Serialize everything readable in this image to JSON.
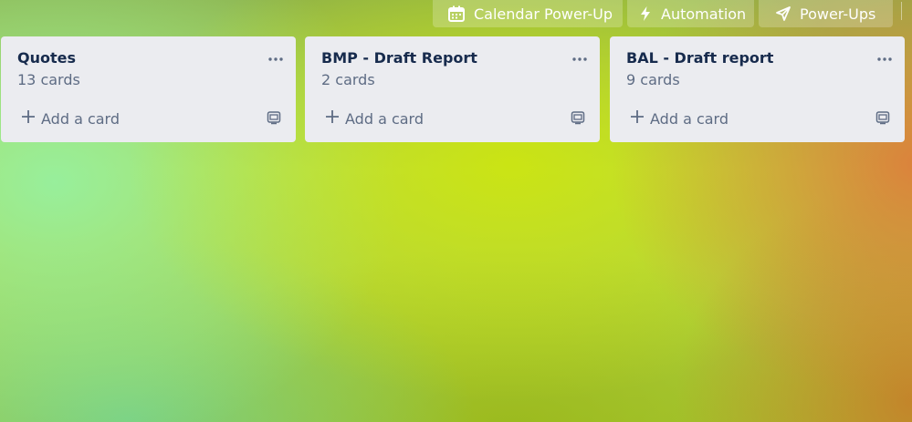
{
  "toolbar": {
    "calendar_label": "Calendar Power-Up",
    "automation_label": "Automation",
    "powerups_label": "Power-Ups"
  },
  "lists": [
    {
      "title": "Quotes",
      "count": "13 cards",
      "add_label": "Add a card"
    },
    {
      "title": "BMP - Draft Report",
      "count": "2 cards",
      "add_label": "Add a card"
    },
    {
      "title": "BAL - Draft report",
      "count": "9 cards",
      "add_label": "Add a card"
    }
  ],
  "icons": {
    "calendar": "calendar-icon",
    "automation": "lightning-icon",
    "powerups": "rocket-icon",
    "list_menu": "more-horizontal-icon",
    "add": "plus-icon",
    "template": "card-template-icon"
  },
  "colors": {
    "list_bg": "#ebecf0",
    "title_text": "#172b4d",
    "muted_text": "#5e6c84"
  }
}
